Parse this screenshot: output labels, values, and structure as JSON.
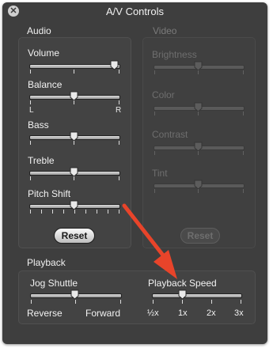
{
  "window": {
    "title": "A/V Controls",
    "close_glyph": "✕"
  },
  "audio": {
    "label": "Audio",
    "sliders": [
      {
        "label": "Volume",
        "value": 1.0
      },
      {
        "label": "Balance",
        "value": 0.5,
        "left_label": "L",
        "right_label": "R"
      },
      {
        "label": "Bass",
        "value": 0.5
      },
      {
        "label": "Treble",
        "value": 0.5
      },
      {
        "label": "Pitch Shift",
        "value": 0.5
      }
    ],
    "reset_label": "Reset"
  },
  "video": {
    "label": "Video",
    "sliders": [
      {
        "label": "Brightness",
        "value": 0.5
      },
      {
        "label": "Color",
        "value": 0.5
      },
      {
        "label": "Contrast",
        "value": 0.5
      },
      {
        "label": "Tint",
        "value": 0.5
      }
    ],
    "reset_label": "Reset"
  },
  "playback": {
    "label": "Playback",
    "jog_shuttle": {
      "label": "Jog Shuttle",
      "value": 0.5,
      "left_label": "Reverse",
      "right_label": "Forward"
    },
    "playback_speed": {
      "label": "Playback Speed",
      "value": 0.333,
      "ticks": [
        "½x",
        "1x",
        "2x",
        "3x"
      ]
    }
  },
  "annotation": {
    "color": "#e8442a",
    "icon": "pointer-arrow-icon"
  }
}
